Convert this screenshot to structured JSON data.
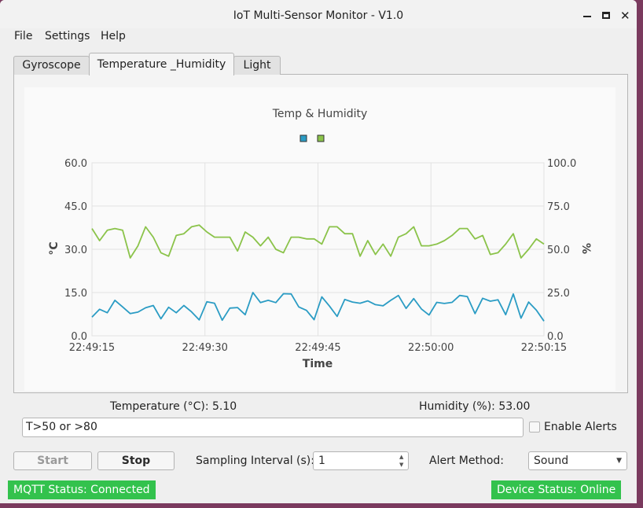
{
  "window": {
    "title": "IoT Multi-Sensor Monitor - V1.0"
  },
  "menu": {
    "file": "File",
    "settings": "Settings",
    "help": "Help"
  },
  "tabs": [
    {
      "label": "Gyroscope",
      "active": false
    },
    {
      "label": "Temperature _Humidity",
      "active": true
    },
    {
      "label": "Light",
      "active": false
    }
  ],
  "chart_data": {
    "type": "line",
    "title": "Temp & Humidity",
    "xlabel": "Time",
    "ylabel_left": "°C",
    "ylabel_right": "%",
    "ylim_left": [
      0,
      60
    ],
    "ylim_right": [
      0,
      100
    ],
    "grid": true,
    "legend": "top-center",
    "x_ticks": [
      "22:49:15",
      "22:49:30",
      "22:49:45",
      "22:50:00",
      "22:50:15"
    ],
    "y_left_ticks": [
      "60.0",
      "45.0",
      "30.0",
      "15.0",
      "0.0"
    ],
    "y_right_ticks": [
      "100.0",
      "75.0",
      "50.0",
      "25.0",
      "0.0"
    ],
    "series": [
      {
        "axis": "left",
        "color": "#2b9cc4",
        "values": [
          6.5,
          9.2,
          8.0,
          12.3,
          10.0,
          7.7,
          8.2,
          9.7,
          10.5,
          5.9,
          9.9,
          8.0,
          10.5,
          8.3,
          5.5,
          11.8,
          11.3,
          5.4,
          9.6,
          9.8,
          7.3,
          15.0,
          11.5,
          12.3,
          11.5,
          14.6,
          14.5,
          10.0,
          8.8,
          5.6,
          13.5,
          10.3,
          6.7,
          12.6,
          11.7,
          11.3,
          12.1,
          10.8,
          10.4,
          12.3,
          14.0,
          9.5,
          12.9,
          9.3,
          7.2,
          11.6,
          11.2,
          11.6,
          14.0,
          13.6,
          7.7,
          13.0,
          12.0,
          12.5,
          7.3,
          14.5,
          6.1,
          11.7,
          8.9,
          5.1
        ]
      },
      {
        "axis": "right",
        "color": "#8bc34a",
        "values": [
          62,
          55,
          61,
          62,
          61,
          45,
          52,
          63,
          57,
          48,
          46,
          58,
          59,
          63,
          64,
          60,
          57,
          57,
          57,
          49,
          60,
          57,
          52,
          57,
          50,
          48,
          57,
          57,
          56,
          56,
          53,
          63,
          63,
          59,
          59,
          46,
          55,
          47,
          53,
          46,
          57,
          59,
          63,
          52,
          52,
          53,
          55,
          58,
          62,
          62,
          56,
          58,
          47,
          48,
          53,
          59,
          45,
          50,
          56,
          53
        ]
      }
    ]
  },
  "readouts": {
    "temperature": "Temperature (°C): 5.10",
    "humidity": "Humidity (%): 53.00"
  },
  "alerts": {
    "threshold_value": "T>50 or >80",
    "enable_label": "Enable Alerts",
    "enabled": false
  },
  "controls": {
    "start_label": "Start",
    "stop_label": "Stop",
    "interval_label": "Sampling Interval (s):",
    "interval_value": "1",
    "alert_method_label": "Alert Method:",
    "alert_method_value": "Sound"
  },
  "status": {
    "mqtt": "MQTT Status: Connected",
    "device": "Device Status: Online",
    "color": "#33c24d"
  }
}
